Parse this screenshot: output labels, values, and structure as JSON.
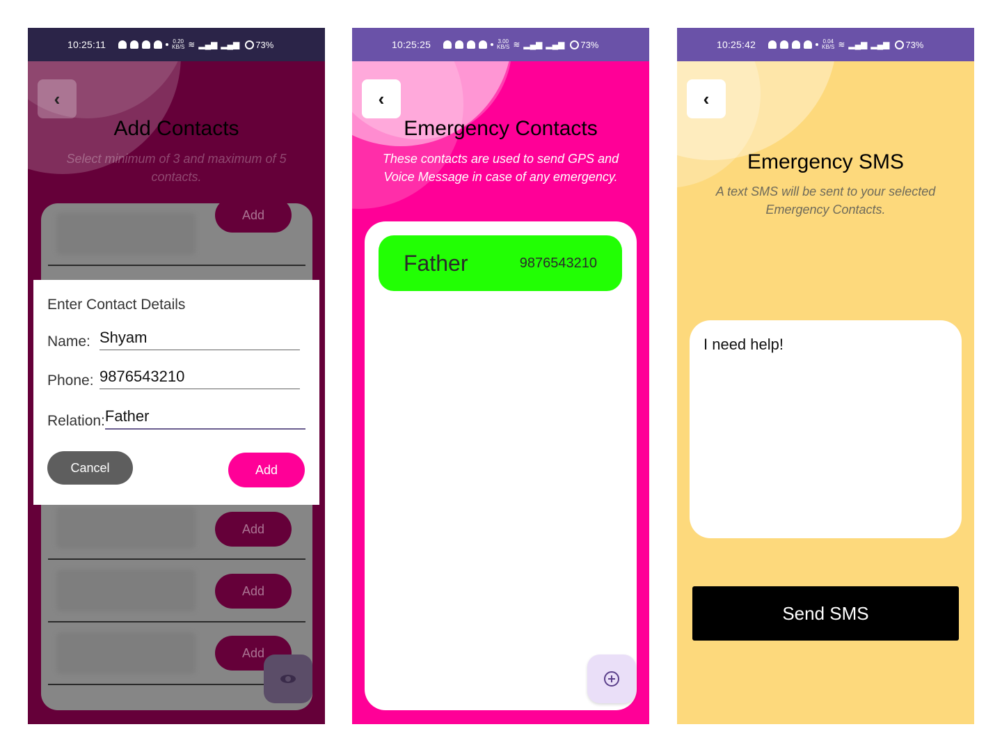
{
  "screens": [
    {
      "status": {
        "time": "10:25:11",
        "speed": "0.20",
        "speed_unit": "KB/S",
        "battery": "73%"
      },
      "back_icon": "‹",
      "title": "Add Contacts",
      "subtitle": "Select minimum of 3 and maximum of 5 contacts.",
      "row_add_label": "Add",
      "dialog": {
        "heading": "Enter Contact Details",
        "name_label": "Name:",
        "name_value": "Shyam",
        "phone_label": "Phone:",
        "phone_value": "9876543210",
        "relation_label": "Relation:",
        "relation_value": "Father",
        "cancel_label": "Cancel",
        "add_label": "Add"
      },
      "fab_icon": "eye-icon"
    },
    {
      "status": {
        "time": "10:25:25",
        "speed": "3.00",
        "speed_unit": "KB/S",
        "battery": "73%"
      },
      "back_icon": "‹",
      "title": "Emergency Contacts",
      "subtitle": "These contacts are used to send GPS and Voice Message in case of any emergency.",
      "contacts": [
        {
          "name": "Father",
          "phone": "9876543210"
        }
      ],
      "fab_icon": "add-circle-icon"
    },
    {
      "status": {
        "time": "10:25:42",
        "speed": "0.04",
        "speed_unit": "KB/S",
        "battery": "73%"
      },
      "back_icon": "‹",
      "title": "Emergency SMS",
      "subtitle": "A text SMS will be sent to your selected Emergency Contacts.",
      "message": "I need help!",
      "send_label": "Send SMS"
    }
  ],
  "colors": {
    "screen1_bg": "#650039",
    "screen2_bg": "#ff0097",
    "screen3_bg": "#fdd97c",
    "contact_chip": "#22ff04",
    "accent_pink": "#ff0097",
    "status_purple": "#6a52a8"
  }
}
